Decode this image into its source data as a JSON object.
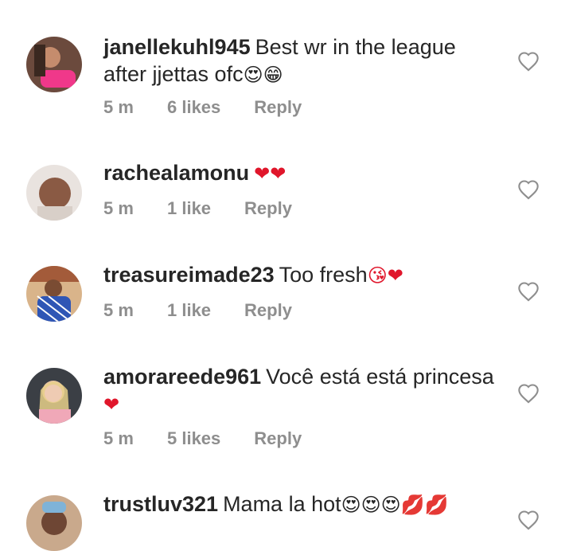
{
  "comments": [
    {
      "username": "janellekuhl945",
      "text": "Best wr in the league after jjettas ofc",
      "emojis": "😍😁",
      "time": "5 m",
      "likes": "6 likes",
      "reply": "Reply"
    },
    {
      "username": "rachealamonu",
      "text": "",
      "emojis": "❤❤",
      "time": "5 m",
      "likes": "1 like",
      "reply": "Reply"
    },
    {
      "username": "treasureimade23",
      "text": "Too fresh",
      "emojis": "😘❤",
      "time": "5 m",
      "likes": "1 like",
      "reply": "Reply"
    },
    {
      "username": "amorareede961",
      "text": "Você está está princesa",
      "emojis": "❤",
      "time": "5 m",
      "likes": "5 likes",
      "reply": "Reply"
    },
    {
      "username": "trustluv321",
      "text": "Mama la hot",
      "emojis": "😍😍😍💋💋",
      "time": "",
      "likes": "",
      "reply": ""
    }
  ],
  "icons": {
    "like": "heart-outline-icon"
  },
  "colors": {
    "text": "#262626",
    "meta": "#8e8e8e",
    "heart": "#e0162b"
  }
}
